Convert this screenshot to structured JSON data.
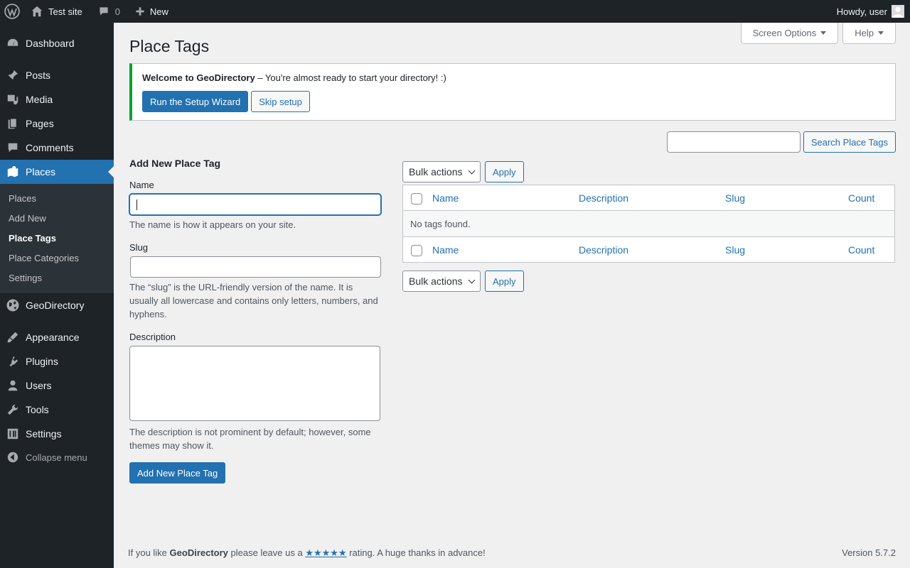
{
  "adminbar": {
    "site_name": "Test site",
    "comments_count": "0",
    "new_label": "New",
    "greeting": "Howdy, user"
  },
  "sidebar": {
    "items": [
      {
        "label": "Dashboard",
        "icon": "dashboard-icon"
      },
      {
        "label": "Posts",
        "icon": "pin-icon"
      },
      {
        "label": "Media",
        "icon": "media-icon"
      },
      {
        "label": "Pages",
        "icon": "pages-icon"
      },
      {
        "label": "Comments",
        "icon": "comment-icon"
      },
      {
        "label": "Places",
        "icon": "map-icon"
      },
      {
        "label": "GeoDirectory",
        "icon": "globe-icon"
      },
      {
        "label": "Appearance",
        "icon": "brush-icon"
      },
      {
        "label": "Plugins",
        "icon": "plugin-icon"
      },
      {
        "label": "Users",
        "icon": "user-icon"
      },
      {
        "label": "Tools",
        "icon": "wrench-icon"
      },
      {
        "label": "Settings",
        "icon": "settings-icon"
      }
    ],
    "submenu": [
      "Places",
      "Add New",
      "Place Tags",
      "Place Categories",
      "Settings"
    ],
    "collapse_label": "Collapse menu"
  },
  "screen_options_label": "Screen Options",
  "help_label": "Help",
  "page_title": "Place Tags",
  "notice": {
    "bold": "Welcome to GeoDirectory",
    "text": " – You're almost ready to start your directory! :)",
    "primary_button": "Run the Setup Wizard",
    "secondary_button": "Skip setup"
  },
  "search_button": "Search Place Tags",
  "form": {
    "heading": "Add New Place Tag",
    "name_label": "Name",
    "name_help": "The name is how it appears on your site.",
    "slug_label": "Slug",
    "slug_help": "The “slug” is the URL-friendly version of the name. It is usually all lowercase and contains only letters, numbers, and hyphens.",
    "description_label": "Description",
    "description_help": "The description is not prominent by default; however, some themes may show it.",
    "submit": "Add New Place Tag"
  },
  "table": {
    "bulk_actions": "Bulk actions",
    "apply": "Apply",
    "columns": [
      "Name",
      "Description",
      "Slug",
      "Count"
    ],
    "empty_message": "No tags found."
  },
  "footer": {
    "prefix": "If you like ",
    "brand": "GeoDirectory",
    "middle": " please leave us a ",
    "stars": "★★★★★",
    "suffix": " rating. A huge thanks in advance!",
    "version": "Version 5.7.2"
  },
  "colors": {
    "accent": "#2271b1",
    "adminbar_bg": "#1d2327",
    "notice_success": "#00a32a"
  }
}
